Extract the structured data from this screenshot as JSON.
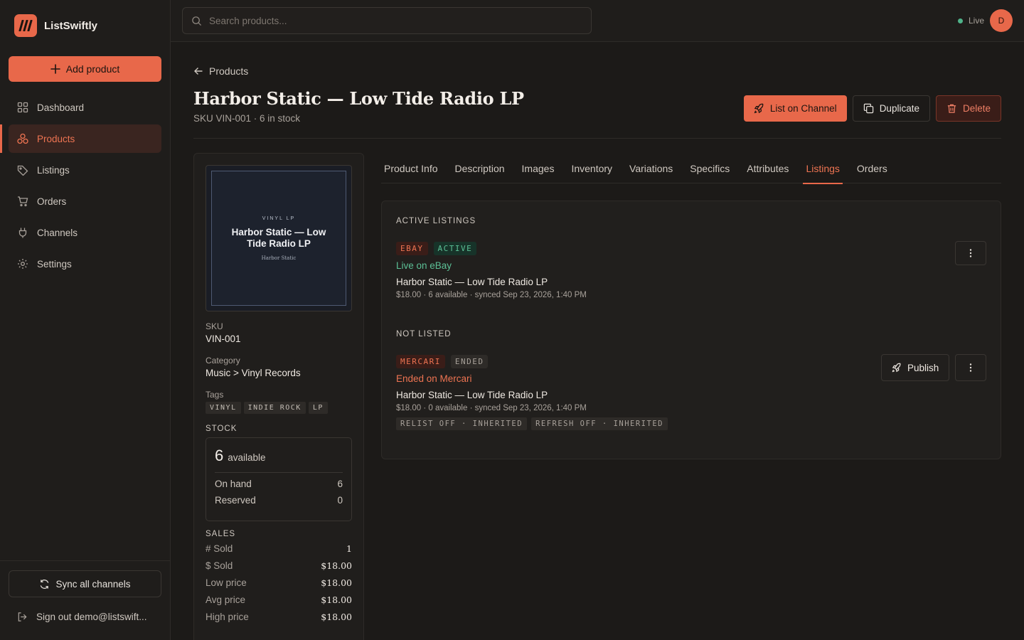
{
  "app": {
    "name": "ListSwiftly"
  },
  "sidebar": {
    "add_label": "Add product",
    "items": [
      {
        "label": "Dashboard",
        "icon": "dashboard-icon"
      },
      {
        "label": "Products",
        "icon": "products-icon",
        "active": true
      },
      {
        "label": "Listings",
        "icon": "tag-icon"
      },
      {
        "label": "Orders",
        "icon": "cart-icon"
      },
      {
        "label": "Channels",
        "icon": "plug-icon"
      },
      {
        "label": "Settings",
        "icon": "gear-icon"
      }
    ],
    "sync_label": "Sync all channels",
    "signout_label": "Sign out demo@listswift..."
  },
  "topbar": {
    "search_placeholder": "Search products...",
    "status_label": "Live",
    "avatar_initial": "D"
  },
  "page": {
    "breadcrumb": "Products",
    "title": "Harbor Static — Low Tide Radio LP",
    "subtitle": "SKU VIN-001 · 6 in stock",
    "actions": {
      "list": "List on Channel",
      "duplicate": "Duplicate",
      "delete": "Delete"
    }
  },
  "product": {
    "cover": {
      "kicker": "VINYL LP",
      "title": "Harbor Static — Low Tide Radio LP",
      "artist": "Harbor Static"
    },
    "sku_label": "SKU",
    "sku": "VIN-001",
    "category_label": "Category",
    "category": "Music > Vinyl Records",
    "tags_label": "Tags",
    "tags": [
      "VINYL",
      "INDIE ROCK",
      "LP"
    ],
    "stock": {
      "label": "STOCK",
      "available": "6",
      "available_label": "available",
      "on_hand_label": "On hand",
      "on_hand": "6",
      "reserved_label": "Reserved",
      "reserved": "0"
    },
    "sales": {
      "label": "SALES",
      "rows": [
        {
          "label": "# Sold",
          "value": "1"
        },
        {
          "label": "$ Sold",
          "value": "$18.00"
        },
        {
          "label": "Low price",
          "value": "$18.00"
        },
        {
          "label": "Avg price",
          "value": "$18.00"
        },
        {
          "label": "High price",
          "value": "$18.00"
        }
      ]
    }
  },
  "tabs": [
    "Product Info",
    "Description",
    "Images",
    "Inventory",
    "Variations",
    "Specifics",
    "Attributes",
    "Listings",
    "Orders"
  ],
  "active_tab": "Listings",
  "listings": {
    "active_header": "ACTIVE LISTINGS",
    "not_listed_header": "NOT LISTED",
    "active": {
      "channel": "EBAY",
      "status": "ACTIVE",
      "status_line": "Live on eBay",
      "title": "Harbor Static — Low Tide Radio LP",
      "meta": "$18.00 · 6 available · synced Sep 23, 2026, 1:40 PM"
    },
    "ended": {
      "channel": "MERCARI",
      "status": "ENDED",
      "status_line": "Ended on Mercari",
      "title": "Harbor Static — Low Tide Radio LP",
      "meta": "$18.00 · 0 available · synced Sep 23, 2026, 1:40 PM",
      "flags": [
        "RELIST OFF · INHERITED",
        "REFRESH OFF · INHERITED"
      ],
      "publish_label": "Publish"
    }
  },
  "colors": {
    "accent": "#e8684a",
    "background": "#1c1a18",
    "success": "#5cc096"
  }
}
